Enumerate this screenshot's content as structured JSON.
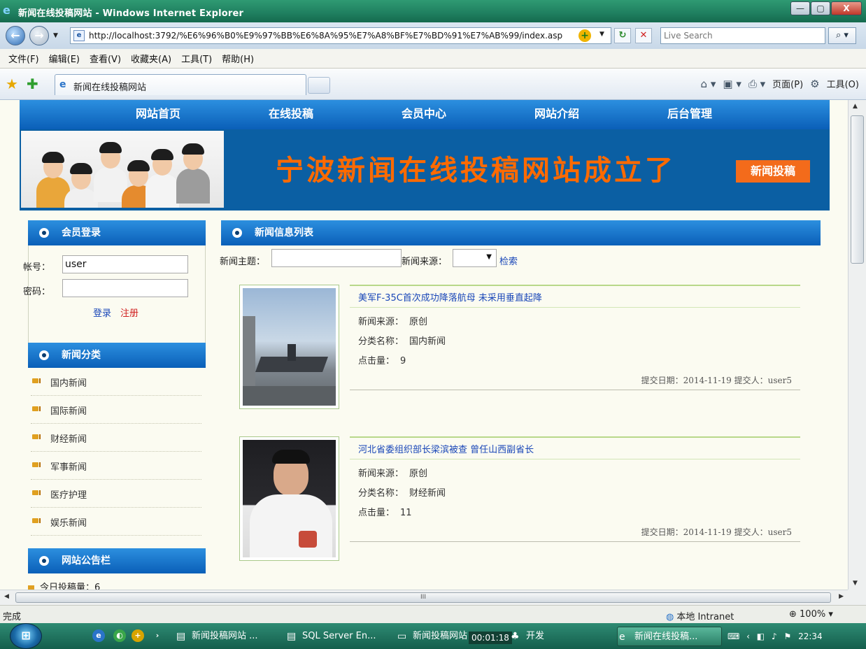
{
  "window": {
    "title": "新闻在线投稿网站 - Windows Internet Explorer",
    "minimize": "—",
    "maximize": "▢",
    "close": "X"
  },
  "address": {
    "url": "http://localhost:3792/%E6%96%B0%E9%97%BB%E6%8A%95%E7%A8%BF%E7%BD%91%E7%AB%99/index.asp",
    "search_placeholder": "Live Search"
  },
  "menu": [
    "文件(F)",
    "编辑(E)",
    "查看(V)",
    "收藏夹(A)",
    "工具(T)",
    "帮助(H)"
  ],
  "tab": {
    "label": "新闻在线投稿网站"
  },
  "commands": {
    "page": "页面(P)",
    "tools": "工具(O)"
  },
  "site": {
    "nav": [
      "网站首页",
      "在线投稿",
      "会员中心",
      "网站介绍",
      "后台管理"
    ],
    "banner_slogan": "宁波新闻在线投稿网站成立了",
    "banner_button": "新闻投稿",
    "login": {
      "title": "会员登录",
      "username_label": "帐号：",
      "username_value": "user",
      "password_label": "密码：",
      "login_link": "登录",
      "register_link": "注册"
    },
    "categories": {
      "title": "新闻分类",
      "items": [
        "国内新闻",
        "国际新闻",
        "财经新闻",
        "军事新闻",
        "医疗护理",
        "娱乐新闻"
      ]
    },
    "notice": {
      "title": "网站公告栏",
      "first_item": "今日投稿量：6"
    },
    "news_list": {
      "title": "新闻信息列表",
      "search": {
        "topic_label": "新闻主题：",
        "source_label": "新闻来源：",
        "search_link": "检索"
      },
      "items": [
        {
          "title": "美军F-35C首次成功降落航母 未采用垂直起降",
          "source_label": "新闻来源：",
          "source": "原创",
          "category_label": "分类名称：",
          "category": "国内新闻",
          "clicks_label": "点击量：",
          "clicks": "9",
          "meta": "提交日期：2014-11-19 提交人：user5"
        },
        {
          "title": "河北省委组织部长梁滨被查 曾任山西副省长",
          "source_label": "新闻来源：",
          "source": "原创",
          "category_label": "分类名称：",
          "category": "财经新闻",
          "clicks_label": "点击量：",
          "clicks": "11",
          "meta": "提交日期：2014-11-19 提交人：user5"
        }
      ]
    }
  },
  "status": {
    "text": "完成",
    "zone": "本地 Intranet",
    "zoom": "100%"
  },
  "taskbar": {
    "items": [
      "新闻投稿网站 ...",
      "SQL Server En...",
      "新闻投稿网站",
      "开发",
      "新闻在线投稿..."
    ],
    "timer": "00:01:18",
    "clock": "22:34"
  },
  "colors": {
    "nav_blue": "#0a5fb8",
    "slogan_orange": "#ff6a00",
    "button_orange": "#f36b1b",
    "link_blue": "#1a47b8"
  }
}
